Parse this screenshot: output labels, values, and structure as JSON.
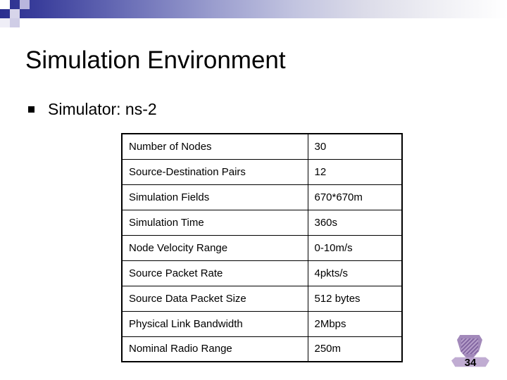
{
  "slide": {
    "title": "Simulation Environment",
    "bullet": {
      "marker": "square-bullet",
      "text": "Simulator: ns-2"
    },
    "page_number": "34"
  },
  "table": {
    "rows": [
      {
        "name": "Number of Nodes",
        "value": "30"
      },
      {
        "name": "Source-Destination Pairs",
        "value": "12"
      },
      {
        "name": "Simulation Fields",
        "value": "670*670m"
      },
      {
        "name": "Simulation Time",
        "value": "360s"
      },
      {
        "name": "Node Velocity Range",
        "value": "0-10m/s"
      },
      {
        "name": "Source Packet Rate",
        "value": "4pkts/s"
      },
      {
        "name": "Source Data Packet Size",
        "value": "512 bytes"
      },
      {
        "name": "Physical Link Bandwidth",
        "value": "2Mbps"
      },
      {
        "name": "Nominal Radio Range",
        "value": "250m"
      }
    ]
  },
  "colors": {
    "band_start": "#2b2f8f",
    "band_end": "#ffffff",
    "text": "#000000",
    "logo": "#9b7fb5"
  }
}
